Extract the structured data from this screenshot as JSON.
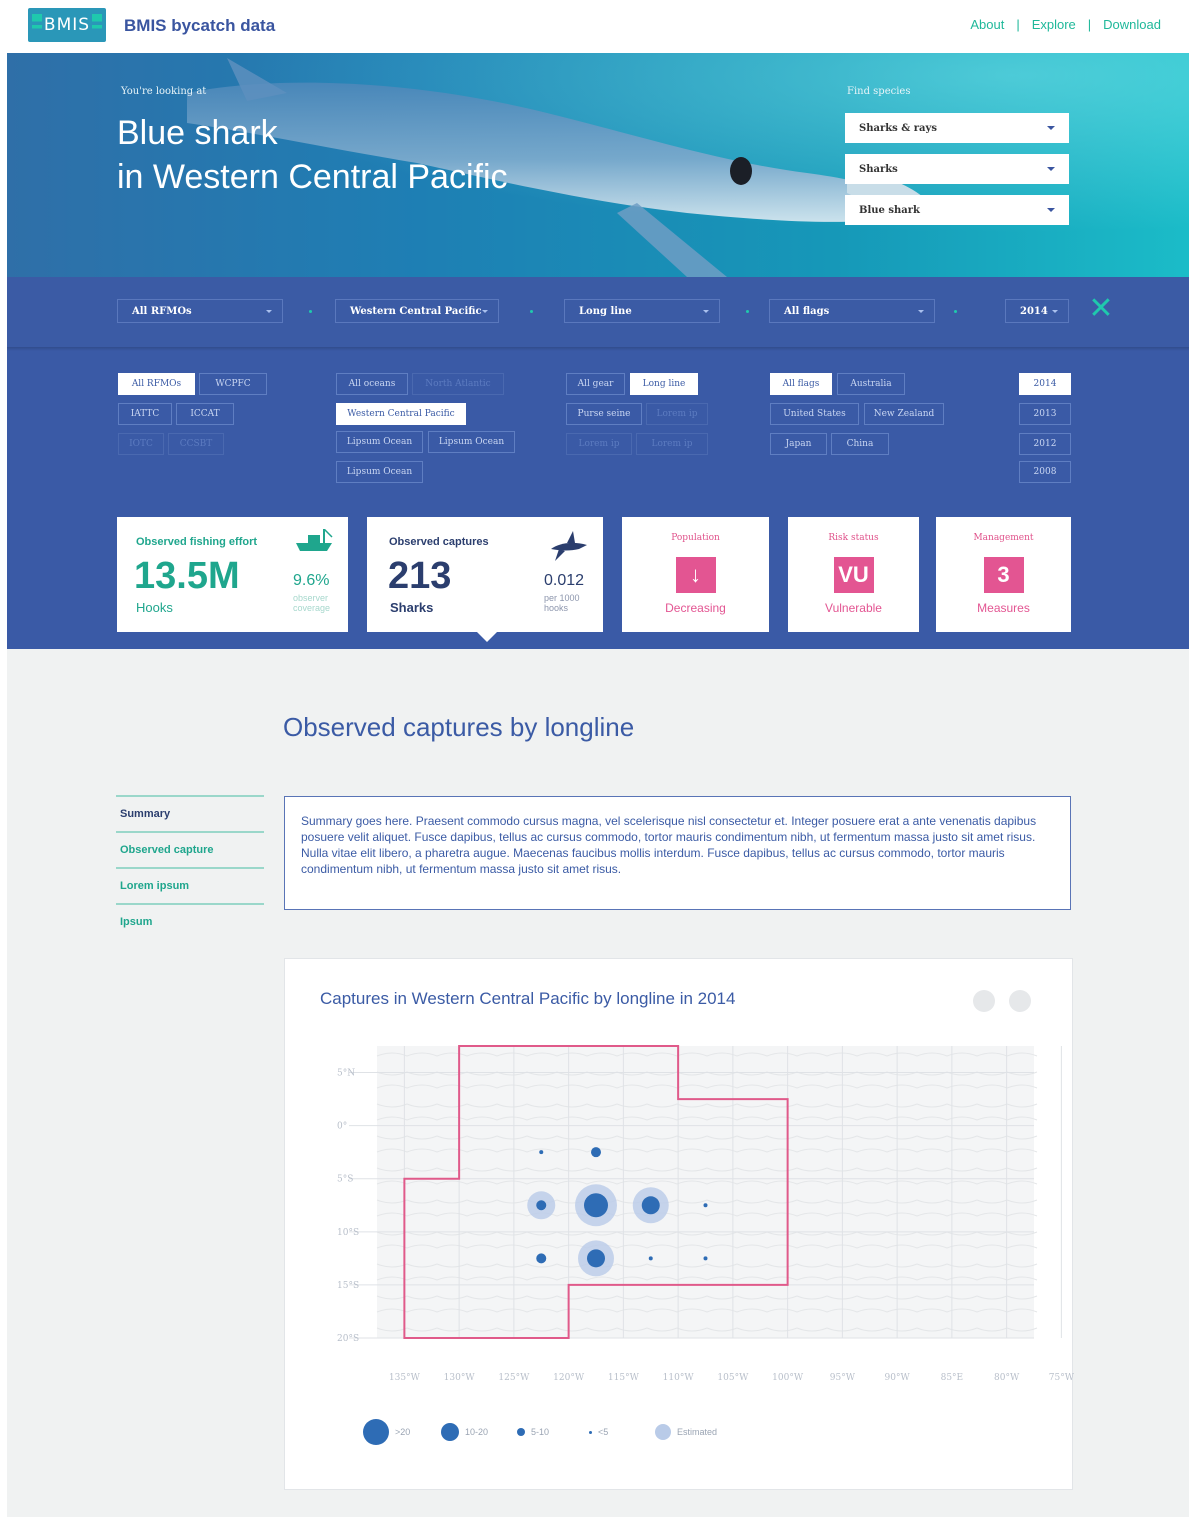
{
  "header": {
    "logo_text": "BMIS",
    "brand": "BMIS bycatch data",
    "nav": [
      {
        "label": "About"
      },
      {
        "label": "Explore"
      },
      {
        "label": "Download"
      }
    ]
  },
  "hero": {
    "looking_label": "You're looking at",
    "title_line1": "Blue shark",
    "title_line2": "in Western Central Pacific",
    "find_label": "Find species",
    "selects": [
      "Sharks & rays",
      "Sharks",
      "Blue shark"
    ]
  },
  "filters": {
    "selects": [
      "All RFMOs",
      "Western Central Pacific",
      "Long line",
      "All flags",
      "2014"
    ],
    "rfmo_chips": [
      "All RFMOs",
      "WCPFC",
      "IATTC",
      "ICCAT",
      "IOTC",
      "CCSBT"
    ],
    "ocean_chips": [
      "All oceans",
      "North Atlantic",
      "Western Central Pacific",
      "Lipsum Ocean",
      "Lipsum Ocean",
      "Lipsum Ocean"
    ],
    "gear_chips": [
      "All gear",
      "Long line",
      "Purse seine",
      "Lorem ip",
      "Lorem ip",
      "Lorem ip"
    ],
    "flag_chips": [
      "All flags",
      "Australia",
      "United States",
      "New Zealand",
      "Japan",
      "China"
    ],
    "year_chips": [
      "2014",
      "2013",
      "2012",
      "2008"
    ]
  },
  "stats": {
    "effort": {
      "label": "Observed fishing effort",
      "value": "13.5M",
      "unit": "Hooks",
      "pct": "9.6%",
      "pct_label": "observer coverage"
    },
    "captures": {
      "label": "Observed captures",
      "value": "213",
      "unit": "Sharks",
      "rate": "0.012",
      "rate_label": "per 1000 hooks"
    },
    "population": {
      "label": "Population",
      "badge": "↓",
      "value": "Decreasing"
    },
    "risk": {
      "label": "Risk status",
      "badge": "VU",
      "value": "Vulnerable"
    },
    "management": {
      "label": "Management",
      "badge": "3",
      "value": "Measures"
    }
  },
  "section": {
    "title": "Observed captures by longline",
    "nav": [
      "Summary",
      "Observed capture",
      "Lorem ipsum",
      "Ipsum"
    ],
    "summary": "Summary goes here. Praesent commodo cursus magna, vel scelerisque nisl consectetur et. Integer posuere erat a ante venenatis dapibus posuere velit aliquet. Fusce dapibus, tellus ac cursus commodo, tortor mauris condimentum nibh, ut fermentum massa justo sit amet risus. Nulla vitae elit libero, a pharetra augue. Maecenas faucibus mollis interdum. Fusce dapibus, tellus ac cursus commodo, tortor mauris condimentum nibh, ut fermentum massa justo sit amet risus."
  },
  "map_chart": {
    "title": "Captures in Western Central Pacific by longline in 2014",
    "lat_labels": [
      "5°N",
      "0°",
      "5°S",
      "10°S",
      "15°S",
      "20°S"
    ],
    "lon_labels": [
      "135°W",
      "130°W",
      "125°W",
      "120°W",
      "115°W",
      "110°W",
      "105°W",
      "100°W",
      "95°W",
      "90°W",
      "85°E",
      "80°W",
      "75°W"
    ],
    "legend": [
      ">20",
      "10-20",
      "5-10",
      "<5",
      "Estimated"
    ],
    "colors": {
      "observed": "#2e6cb5",
      "estimated": "#b9cbe8",
      "region_outline": "#e05a8a"
    }
  },
  "chart_data": {
    "type": "scatter",
    "title": "Captures in Western Central Pacific by longline in 2014",
    "xlabel": "",
    "ylabel": "",
    "x_ticks": [
      "135°W",
      "130°W",
      "125°W",
      "120°W",
      "115°W",
      "110°W",
      "105°W",
      "100°W",
      "95°W",
      "90°W",
      "85°E",
      "80°W",
      "75°W"
    ],
    "y_ticks": [
      "5°N",
      "0°",
      "5°S",
      "10°S",
      "15°S",
      "20°S"
    ],
    "points": [
      {
        "lon": -122.5,
        "lat": -2.5,
        "class": "<5",
        "estimated": false
      },
      {
        "lon": -117.5,
        "lat": -2.5,
        "class": "5-10",
        "estimated": false
      },
      {
        "lon": -122.5,
        "lat": -7.5,
        "class": "5-10",
        "estimated": true
      },
      {
        "lon": -117.5,
        "lat": -7.5,
        "class": ">20",
        "estimated": true
      },
      {
        "lon": -112.5,
        "lat": -7.5,
        "class": "10-20",
        "estimated": true
      },
      {
        "lon": -107.5,
        "lat": -7.5,
        "class": "<5",
        "estimated": false
      },
      {
        "lon": -122.5,
        "lat": -12.5,
        "class": "5-10",
        "estimated": false
      },
      {
        "lon": -117.5,
        "lat": -12.5,
        "class": "10-20",
        "estimated": true
      },
      {
        "lon": -112.5,
        "lat": -12.5,
        "class": "<5",
        "estimated": false
      },
      {
        "lon": -107.5,
        "lat": -12.5,
        "class": "<5",
        "estimated": false
      }
    ]
  }
}
